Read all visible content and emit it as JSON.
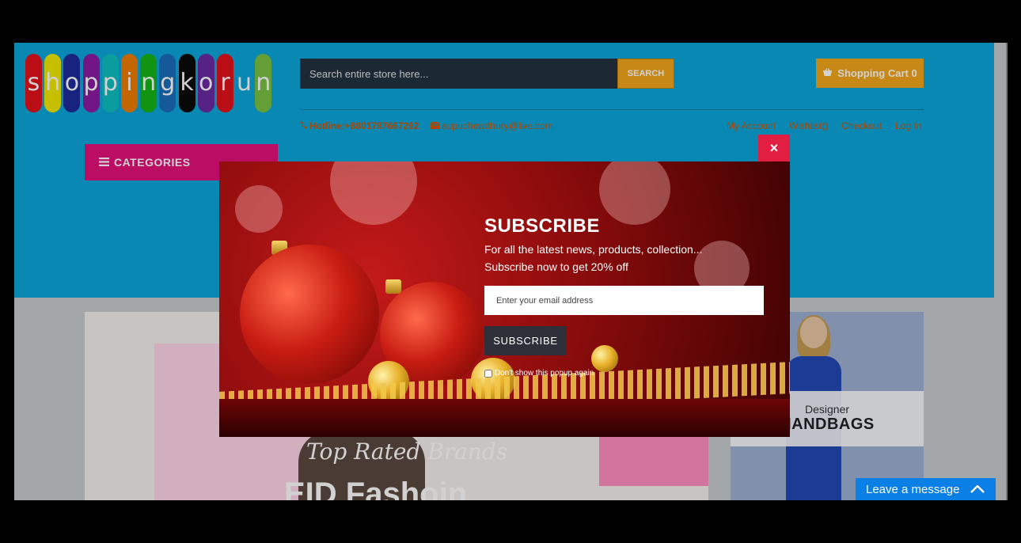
{
  "logo": {
    "letters": [
      "s",
      "h",
      "o",
      "p",
      "p",
      "i",
      "n",
      "g",
      "k",
      "o",
      "r",
      "u",
      "n"
    ],
    "colors": [
      "#e3121d",
      "#f2e900",
      "#1e2b9c",
      "#8d1aa3",
      "#0ec0c0",
      "#f07d00",
      "#16b516",
      "#1c6dbb",
      "#0a0a0a",
      "#6a2aa0",
      "#e3121d",
      "#0aa7db",
      "#7ac142"
    ]
  },
  "header": {
    "search_placeholder": "Search entire store here...",
    "search_button": "SEARCH",
    "cart_label": "Shopping Cart 0",
    "hotline": "Hotline:+8801787667262",
    "email": "aupuchowdhury@live.com",
    "links": [
      "My Account",
      "Wishlist()",
      "Checkout",
      "Log In"
    ],
    "categories_label": "CATEGORIES"
  },
  "banner": {
    "script_text": "Top Rated Brands",
    "headline": "EID Fashoin"
  },
  "side_card": {
    "small": "Designer",
    "big": "HANDBAGS"
  },
  "popup": {
    "title": "SUBSCRIBE",
    "line1": "For all the latest news, products, collection...",
    "line2": "Subscribe now to get 20% off",
    "email_placeholder": "Enter your email address",
    "button": "SUBSCRIBE",
    "dont_show": "Don't show this popup again",
    "close": "×"
  },
  "chat": {
    "label": "Leave a message"
  },
  "colors": {
    "header_bg": "#0aa7db",
    "accent_orange": "#f3a61a",
    "categories_pink": "#e5117a",
    "close_red": "#e31e43",
    "chat_blue": "#0a7fe6"
  }
}
